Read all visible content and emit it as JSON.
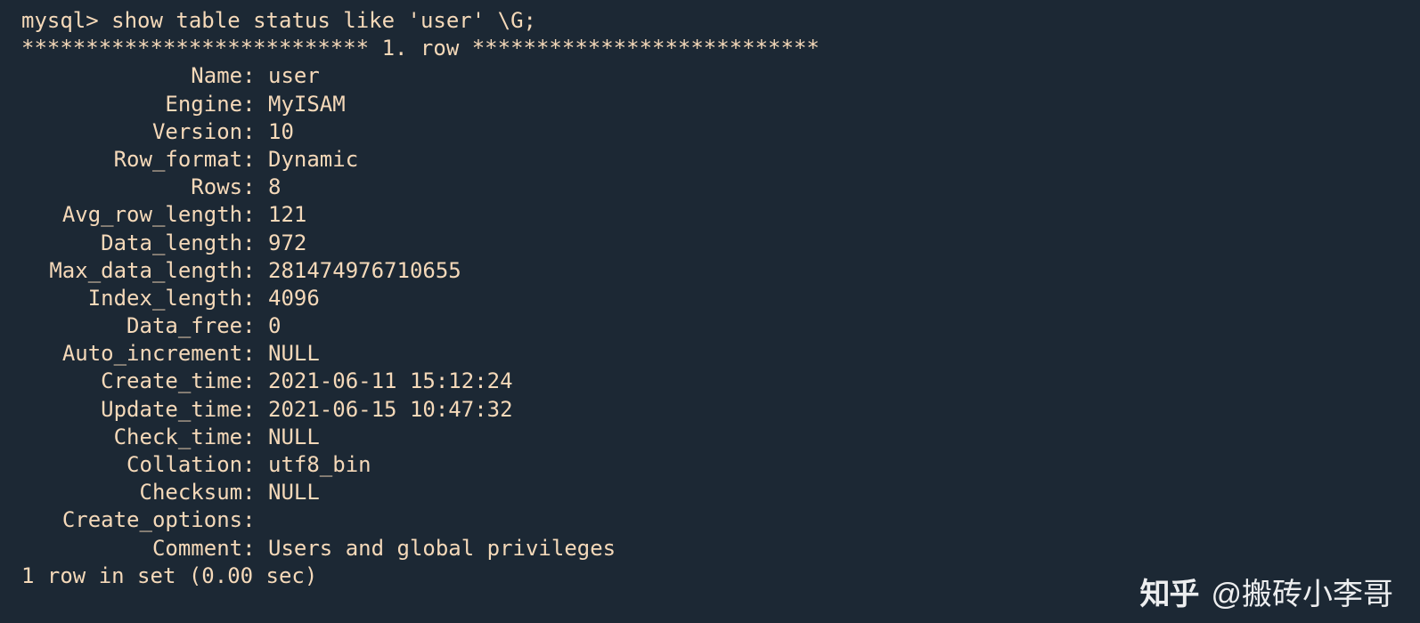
{
  "prompt": "mysql> ",
  "command": "show table status like 'user' \\G;",
  "row_header": "*************************** 1. row ***************************",
  "fields": [
    {
      "key": "Name",
      "value": "user"
    },
    {
      "key": "Engine",
      "value": "MyISAM"
    },
    {
      "key": "Version",
      "value": "10"
    },
    {
      "key": "Row_format",
      "value": "Dynamic"
    },
    {
      "key": "Rows",
      "value": "8"
    },
    {
      "key": "Avg_row_length",
      "value": "121"
    },
    {
      "key": "Data_length",
      "value": "972"
    },
    {
      "key": "Max_data_length",
      "value": "281474976710655"
    },
    {
      "key": "Index_length",
      "value": "4096"
    },
    {
      "key": "Data_free",
      "value": "0"
    },
    {
      "key": "Auto_increment",
      "value": "NULL"
    },
    {
      "key": "Create_time",
      "value": "2021-06-11 15:12:24"
    },
    {
      "key": "Update_time",
      "value": "2021-06-15 10:47:32"
    },
    {
      "key": "Check_time",
      "value": "NULL"
    },
    {
      "key": "Collation",
      "value": "utf8_bin"
    },
    {
      "key": "Checksum",
      "value": "NULL"
    },
    {
      "key": "Create_options",
      "value": ""
    },
    {
      "key": "Comment",
      "value": "Users and global privileges"
    }
  ],
  "footer": "1 row in set (0.00 sec)",
  "watermark": {
    "logo": "知乎",
    "text": "@搬砖小李哥"
  }
}
